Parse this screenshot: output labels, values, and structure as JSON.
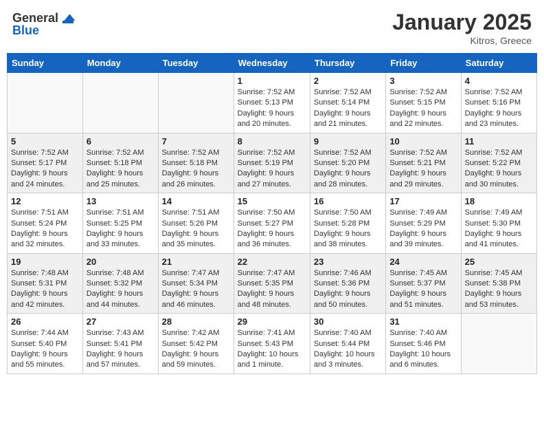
{
  "header": {
    "logo_general": "General",
    "logo_blue": "Blue",
    "month_title": "January 2025",
    "location": "Kitros, Greece"
  },
  "weekdays": [
    "Sunday",
    "Monday",
    "Tuesday",
    "Wednesday",
    "Thursday",
    "Friday",
    "Saturday"
  ],
  "weeks": [
    [
      {
        "day": "",
        "info": ""
      },
      {
        "day": "",
        "info": ""
      },
      {
        "day": "",
        "info": ""
      },
      {
        "day": "1",
        "info": "Sunrise: 7:52 AM\nSunset: 5:13 PM\nDaylight: 9 hours\nand 20 minutes."
      },
      {
        "day": "2",
        "info": "Sunrise: 7:52 AM\nSunset: 5:14 PM\nDaylight: 9 hours\nand 21 minutes."
      },
      {
        "day": "3",
        "info": "Sunrise: 7:52 AM\nSunset: 5:15 PM\nDaylight: 9 hours\nand 22 minutes."
      },
      {
        "day": "4",
        "info": "Sunrise: 7:52 AM\nSunset: 5:16 PM\nDaylight: 9 hours\nand 23 minutes."
      }
    ],
    [
      {
        "day": "5",
        "info": "Sunrise: 7:52 AM\nSunset: 5:17 PM\nDaylight: 9 hours\nand 24 minutes."
      },
      {
        "day": "6",
        "info": "Sunrise: 7:52 AM\nSunset: 5:18 PM\nDaylight: 9 hours\nand 25 minutes."
      },
      {
        "day": "7",
        "info": "Sunrise: 7:52 AM\nSunset: 5:18 PM\nDaylight: 9 hours\nand 26 minutes."
      },
      {
        "day": "8",
        "info": "Sunrise: 7:52 AM\nSunset: 5:19 PM\nDaylight: 9 hours\nand 27 minutes."
      },
      {
        "day": "9",
        "info": "Sunrise: 7:52 AM\nSunset: 5:20 PM\nDaylight: 9 hours\nand 28 minutes."
      },
      {
        "day": "10",
        "info": "Sunrise: 7:52 AM\nSunset: 5:21 PM\nDaylight: 9 hours\nand 29 minutes."
      },
      {
        "day": "11",
        "info": "Sunrise: 7:52 AM\nSunset: 5:22 PM\nDaylight: 9 hours\nand 30 minutes."
      }
    ],
    [
      {
        "day": "12",
        "info": "Sunrise: 7:51 AM\nSunset: 5:24 PM\nDaylight: 9 hours\nand 32 minutes."
      },
      {
        "day": "13",
        "info": "Sunrise: 7:51 AM\nSunset: 5:25 PM\nDaylight: 9 hours\nand 33 minutes."
      },
      {
        "day": "14",
        "info": "Sunrise: 7:51 AM\nSunset: 5:26 PM\nDaylight: 9 hours\nand 35 minutes."
      },
      {
        "day": "15",
        "info": "Sunrise: 7:50 AM\nSunset: 5:27 PM\nDaylight: 9 hours\nand 36 minutes."
      },
      {
        "day": "16",
        "info": "Sunrise: 7:50 AM\nSunset: 5:28 PM\nDaylight: 9 hours\nand 38 minutes."
      },
      {
        "day": "17",
        "info": "Sunrise: 7:49 AM\nSunset: 5:29 PM\nDaylight: 9 hours\nand 39 minutes."
      },
      {
        "day": "18",
        "info": "Sunrise: 7:49 AM\nSunset: 5:30 PM\nDaylight: 9 hours\nand 41 minutes."
      }
    ],
    [
      {
        "day": "19",
        "info": "Sunrise: 7:48 AM\nSunset: 5:31 PM\nDaylight: 9 hours\nand 42 minutes."
      },
      {
        "day": "20",
        "info": "Sunrise: 7:48 AM\nSunset: 5:32 PM\nDaylight: 9 hours\nand 44 minutes."
      },
      {
        "day": "21",
        "info": "Sunrise: 7:47 AM\nSunset: 5:34 PM\nDaylight: 9 hours\nand 46 minutes."
      },
      {
        "day": "22",
        "info": "Sunrise: 7:47 AM\nSunset: 5:35 PM\nDaylight: 9 hours\nand 48 minutes."
      },
      {
        "day": "23",
        "info": "Sunrise: 7:46 AM\nSunset: 5:36 PM\nDaylight: 9 hours\nand 50 minutes."
      },
      {
        "day": "24",
        "info": "Sunrise: 7:45 AM\nSunset: 5:37 PM\nDaylight: 9 hours\nand 51 minutes."
      },
      {
        "day": "25",
        "info": "Sunrise: 7:45 AM\nSunset: 5:38 PM\nDaylight: 9 hours\nand 53 minutes."
      }
    ],
    [
      {
        "day": "26",
        "info": "Sunrise: 7:44 AM\nSunset: 5:40 PM\nDaylight: 9 hours\nand 55 minutes."
      },
      {
        "day": "27",
        "info": "Sunrise: 7:43 AM\nSunset: 5:41 PM\nDaylight: 9 hours\nand 57 minutes."
      },
      {
        "day": "28",
        "info": "Sunrise: 7:42 AM\nSunset: 5:42 PM\nDaylight: 9 hours\nand 59 minutes."
      },
      {
        "day": "29",
        "info": "Sunrise: 7:41 AM\nSunset: 5:43 PM\nDaylight: 10 hours\nand 1 minute."
      },
      {
        "day": "30",
        "info": "Sunrise: 7:40 AM\nSunset: 5:44 PM\nDaylight: 10 hours\nand 3 minutes."
      },
      {
        "day": "31",
        "info": "Sunrise: 7:40 AM\nSunset: 5:46 PM\nDaylight: 10 hours\nand 6 minutes."
      },
      {
        "day": "",
        "info": ""
      }
    ]
  ]
}
